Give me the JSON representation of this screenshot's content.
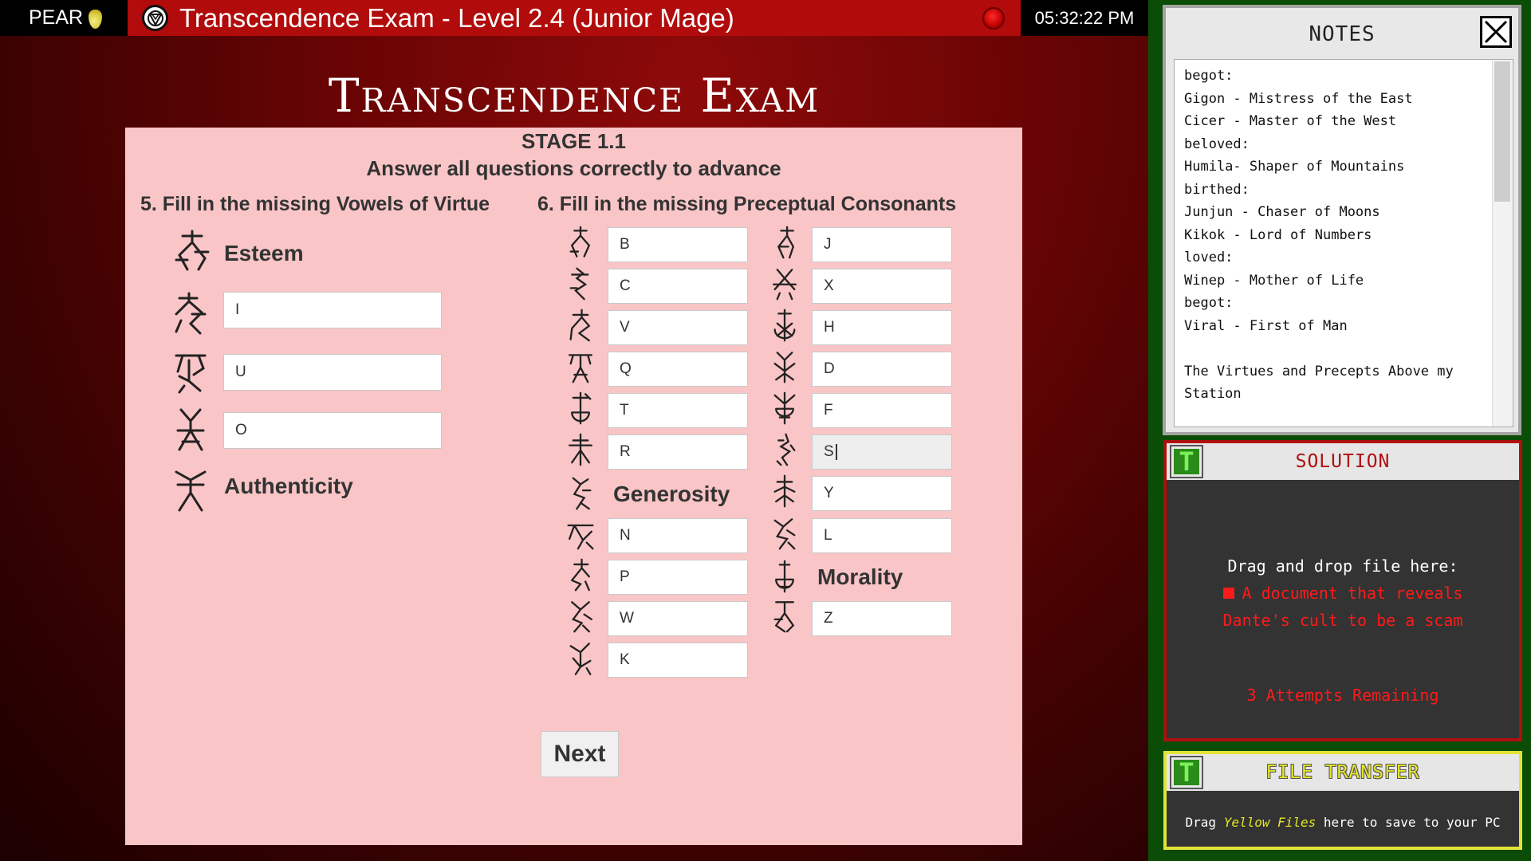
{
  "os": {
    "name": "PEAR",
    "clock": "05:32:22 PM"
  },
  "tab": {
    "title": "Transcendence Exam - Level 2.4 (Junior Mage)"
  },
  "exam": {
    "heading": "Transcendence Exam",
    "stage": "STAGE 1.1",
    "instructions": "Answer all questions correctly to advance",
    "q5": {
      "title": "5. Fill in the missing Vowels of Virtue",
      "word_top": "Esteem",
      "fields": [
        "I",
        "U",
        "O"
      ],
      "word_bottom": "Authenticity"
    },
    "q6": {
      "title": "6. Fill in the missing Preceptual Consonants",
      "col1_fields": [
        "B",
        "C",
        "V",
        "Q",
        "T",
        "R"
      ],
      "col1_word": "Generosity",
      "col1_fields_after": [
        "N",
        "P",
        "W",
        "K"
      ],
      "col2_fields": [
        "J",
        "X",
        "H",
        "D",
        "F",
        "S",
        "Y",
        "L"
      ],
      "col2_word": "Morality",
      "col2_fields_after": [
        "Z"
      ]
    },
    "next_label": "Next"
  },
  "notes": {
    "title": "NOTES",
    "text": "begot:\nGigon - Mistress of the East\nCicer - Master of the West\nbeloved:\nHumila- Shaper of Mountains\nbirthed:\nJunjun - Chaser of Moons\nKikok - Lord of Numbers\nloved:\nWinep - Mother of Life\nbegot:\nViral - First of Man\n\nThe Virtues and Precepts Above my Station"
  },
  "solution": {
    "title": "SOLUTION",
    "icon_letter": "T",
    "drag_text": "Drag and drop file here:",
    "item_line1": "A document that reveals",
    "item_line2": "Dante's cult to be a scam",
    "attempts": "3 Attempts Remaining"
  },
  "transfer": {
    "title": "FILE TRANSFER",
    "icon_letter": "T",
    "text_before": "Drag",
    "text_yellow": "Yellow Files",
    "text_after": "here to save to your PC"
  },
  "colors": {
    "bg_red": "#6a0404",
    "tab_red": "#b10b0b",
    "panel_pink": "#f9c5c7",
    "sidebar_green": "#0b4d07",
    "solution_red": "#b00f0f",
    "transfer_yellow": "#e3e33a"
  }
}
